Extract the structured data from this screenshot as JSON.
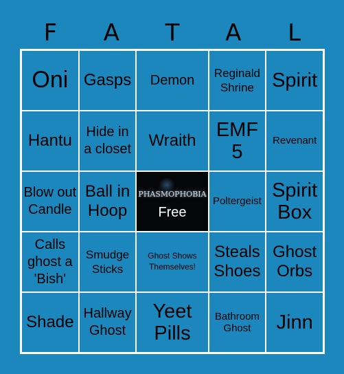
{
  "header": {
    "letters": [
      "F",
      "A",
      "T",
      "A",
      "L"
    ]
  },
  "colors": {
    "background": "#1c87bc",
    "grid_lines": "#ffffff",
    "free_bg": "#050608"
  },
  "cells": [
    [
      "Oni",
      "Gasps",
      "Demon",
      "Reginald Shrine",
      "Spirit"
    ],
    [
      "Hantu",
      "Hide in a closet",
      "Wraith",
      "EMF 5",
      "Revenant"
    ],
    [
      "Blow out Candle",
      "Ball in Hoop",
      "FREE",
      "Poltergeist",
      "Spirit Box"
    ],
    [
      "Calls ghost a 'Bish'",
      "Smudge Sticks",
      "Ghost Shows Themselves!",
      "Steals Shoes",
      "Ghost Orbs"
    ],
    [
      "Shade",
      "Hallway Ghost",
      "Yeet Pills",
      "Bathroom Ghost",
      "Jinn"
    ]
  ],
  "free_cell": {
    "logo_text": "PHASMOPHOBIA",
    "label": "Free"
  }
}
